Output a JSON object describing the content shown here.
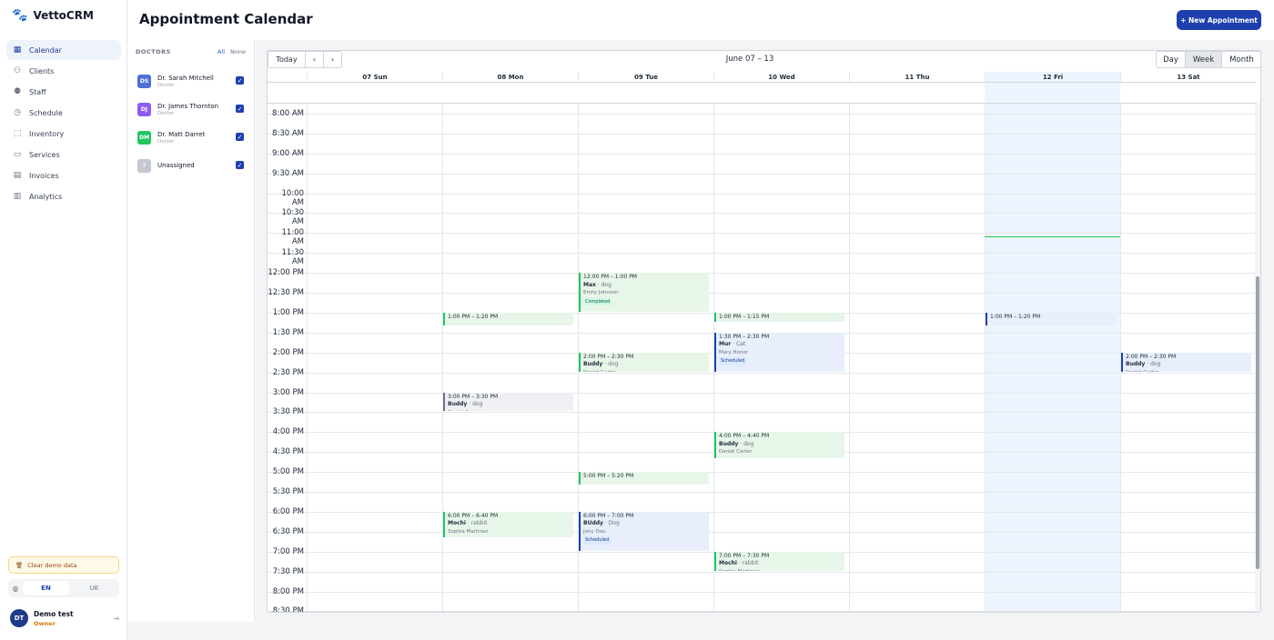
{
  "app": {
    "name": "VettoCRM"
  },
  "nav": [
    {
      "label": "Calendar",
      "icon": "calendar-icon",
      "active": true
    },
    {
      "label": "Clients",
      "icon": "clients-icon"
    },
    {
      "label": "Staff",
      "icon": "staff-icon"
    },
    {
      "label": "Schedule",
      "icon": "clock-icon"
    },
    {
      "label": "Inventory",
      "icon": "box-icon"
    },
    {
      "label": "Services",
      "icon": "briefcase-icon"
    },
    {
      "label": "Invoices",
      "icon": "clipboard-icon"
    },
    {
      "label": "Analytics",
      "icon": "chart-icon"
    }
  ],
  "sidebar_footer": {
    "clear_demo": "Clear demo data",
    "languages": [
      "EN",
      "UK"
    ],
    "user": {
      "initials": "DT",
      "name": "Demo test",
      "role": "Owner"
    }
  },
  "header": {
    "title": "Appointment Calendar",
    "new_button": "+ New Appointment"
  },
  "doctors_panel": {
    "heading": "DOCTORS",
    "all": "All",
    "none": "None",
    "items": [
      {
        "initials": "DS",
        "name": "Dr. Sarah Mitchell",
        "role": "Doctor",
        "color": "#4f6fd6"
      },
      {
        "initials": "DJ",
        "name": "Dr. James Thornton",
        "role": "Doctor",
        "color": "#8b5cf6"
      },
      {
        "initials": "DM",
        "name": "Dr. Matt Darret",
        "role": "Doctor",
        "color": "#22c55e"
      },
      {
        "initials": "?",
        "name": "Unassigned",
        "role": "",
        "color": "#c4c8d0"
      }
    ]
  },
  "calendar": {
    "today": "Today",
    "prev": "‹",
    "next": "›",
    "range": "June 07 – 13",
    "views": [
      "Day",
      "Week",
      "Month"
    ],
    "active_view": "Week",
    "days": [
      "07 Sun",
      "08 Mon",
      "09 Tue",
      "10 Wed",
      "11 Thu",
      "12 Fri",
      "13 Sat"
    ],
    "today_column": "12 Fri",
    "times": [
      "8:00 AM",
      "8:30 AM",
      "9:00 AM",
      "9:30 AM",
      "10:00 AM",
      "10:30 AM",
      "11:00 AM",
      "11:30 AM",
      "12:00 PM",
      "12:30 PM",
      "1:00 PM",
      "1:30 PM",
      "2:00 PM",
      "2:30 PM",
      "3:00 PM",
      "3:30 PM",
      "4:00 PM",
      "4:30 PM",
      "5:00 PM",
      "5:30 PM",
      "6:00 PM",
      "6:30 PM",
      "7:00 PM",
      "7:30 PM",
      "8:00 PM",
      "8:30 PM"
    ],
    "events": [
      {
        "day": 2,
        "start": 12.0,
        "end": 13.0,
        "time": "12:00 PM – 1:00 PM",
        "pet": "Max",
        "species": "dog",
        "owner": "Emily Johnson",
        "status": "Completed",
        "color": "green"
      },
      {
        "day": 1,
        "start": 13.0,
        "end": 13.333,
        "time": "1:00 PM – 1:20 PM",
        "color": "green"
      },
      {
        "day": 3,
        "start": 13.0,
        "end": 13.25,
        "time": "1:00 PM – 1:15 PM",
        "color": "green"
      },
      {
        "day": 5,
        "start": 13.0,
        "end": 13.333,
        "time": "1:00 PM – 1:20 PM",
        "color": "blue"
      },
      {
        "day": 3,
        "start": 13.5,
        "end": 14.5,
        "time": "1:30 PM – 2:30 PM",
        "pet": "Mur",
        "species": "Cat",
        "owner": "Mary Honor",
        "status": "Scheduled",
        "color": "blue"
      },
      {
        "day": 2,
        "start": 14.0,
        "end": 14.5,
        "time": "2:00 PM – 2:30 PM",
        "pet": "Buddy",
        "species": "dog",
        "owner": "Daniel Carter",
        "color": "green"
      },
      {
        "day": 6,
        "start": 14.0,
        "end": 14.5,
        "time": "2:00 PM – 2:30 PM",
        "pet": "Buddy",
        "species": "dog",
        "owner": "Daniel Carter",
        "color": "blue"
      },
      {
        "day": 1,
        "start": 15.0,
        "end": 15.5,
        "time": "3:00 PM – 3:30 PM",
        "pet": "Buddy",
        "species": "dog",
        "owner": "Daniel Carter",
        "color": "gray"
      },
      {
        "day": 3,
        "start": 16.0,
        "end": 16.667,
        "time": "4:00 PM – 4:40 PM",
        "pet": "Buddy",
        "species": "dog",
        "owner": "Daniel Carter",
        "color": "green"
      },
      {
        "day": 2,
        "start": 17.0,
        "end": 17.333,
        "time": "5:00 PM – 5:20 PM",
        "color": "green"
      },
      {
        "day": 1,
        "start": 18.0,
        "end": 18.667,
        "time": "6:00 PM – 6:40 PM",
        "pet": "Mochi",
        "species": "rabbit",
        "owner": "Sophia Martinez",
        "color": "green"
      },
      {
        "day": 2,
        "start": 18.0,
        "end": 19.0,
        "time": "6:00 PM – 7:00 PM",
        "pet": "BUddy",
        "species": "Dog",
        "owner": "Jony Dou",
        "status": "Scheduled",
        "color": "blue"
      },
      {
        "day": 3,
        "start": 19.0,
        "end": 19.5,
        "time": "7:00 PM – 7:30 PM",
        "pet": "Mochi",
        "species": "rabbit",
        "owner": "Sophia Martinez",
        "color": "green"
      }
    ]
  }
}
